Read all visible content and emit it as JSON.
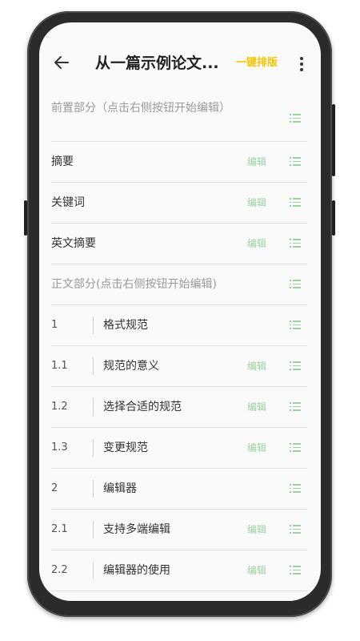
{
  "header": {
    "title": "从一篇示例论文...",
    "format_button": "一键排版"
  },
  "colors": {
    "accent_yellow": "#f5c400",
    "edit_green": "#9ad3a0",
    "section_gray": "#9a9a9a"
  },
  "icons": [
    "back-arrow-icon",
    "more-vert-icon",
    "list-icon"
  ],
  "rows": [
    {
      "type": "section",
      "label": "前置部分（点击右侧按钮开始编辑）"
    },
    {
      "type": "plain",
      "label": "摘要",
      "edit": "编辑"
    },
    {
      "type": "plain",
      "label": "关键词",
      "edit": "编辑"
    },
    {
      "type": "plain",
      "label": "英文摘要",
      "edit": "编辑"
    },
    {
      "type": "section",
      "label": "正文部分(点击右侧按钮开始编辑)"
    },
    {
      "type": "numbered",
      "num": "1",
      "label": "格式规范"
    },
    {
      "type": "numbered",
      "num": "1.1",
      "label": "规范的意义",
      "edit": "编辑"
    },
    {
      "type": "numbered",
      "num": "1.2",
      "label": "选择合适的规范",
      "edit": "编辑"
    },
    {
      "type": "numbered",
      "num": "1.3",
      "label": "变更规范",
      "edit": "编辑"
    },
    {
      "type": "numbered",
      "num": "2",
      "label": "编辑器"
    },
    {
      "type": "numbered",
      "num": "2.1",
      "label": "支持多端编辑",
      "edit": "编辑"
    },
    {
      "type": "numbered",
      "num": "2.2",
      "label": "编辑器的使用",
      "edit": "编辑"
    }
  ]
}
